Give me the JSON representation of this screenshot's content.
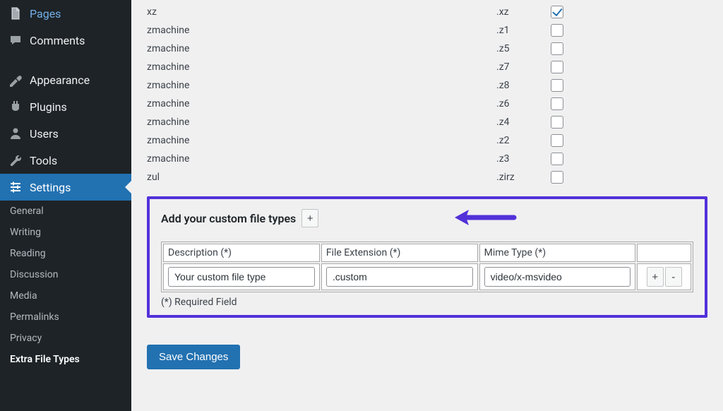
{
  "sidebar": {
    "nav": [
      {
        "label": "Pages",
        "icon": "pages-icon"
      },
      {
        "label": "Comments",
        "icon": "comments-icon"
      },
      {
        "label": "Appearance",
        "icon": "appearance-icon"
      },
      {
        "label": "Plugins",
        "icon": "plugins-icon"
      },
      {
        "label": "Users",
        "icon": "users-icon"
      },
      {
        "label": "Tools",
        "icon": "tools-icon"
      },
      {
        "label": "Settings",
        "icon": "settings-icon",
        "active": true
      }
    ],
    "sub": [
      {
        "label": "General"
      },
      {
        "label": "Writing"
      },
      {
        "label": "Reading"
      },
      {
        "label": "Discussion"
      },
      {
        "label": "Media"
      },
      {
        "label": "Permalinks"
      },
      {
        "label": "Privacy"
      },
      {
        "label": "Extra File Types",
        "current": true
      }
    ]
  },
  "file_types": [
    {
      "desc": "xz",
      "ext": ".xz",
      "checked": true
    },
    {
      "desc": "zmachine",
      "ext": ".z1",
      "checked": false
    },
    {
      "desc": "zmachine",
      "ext": ".z5",
      "checked": false
    },
    {
      "desc": "zmachine",
      "ext": ".z7",
      "checked": false
    },
    {
      "desc": "zmachine",
      "ext": ".z8",
      "checked": false
    },
    {
      "desc": "zmachine",
      "ext": ".z6",
      "checked": false
    },
    {
      "desc": "zmachine",
      "ext": ".z4",
      "checked": false
    },
    {
      "desc": "zmachine",
      "ext": ".z2",
      "checked": false
    },
    {
      "desc": "zmachine",
      "ext": ".z3",
      "checked": false
    },
    {
      "desc": "zul",
      "ext": ".zirz",
      "checked": false
    }
  ],
  "custom_section": {
    "title": "Add your custom file types",
    "add_label": "+",
    "headers": {
      "desc": "Description (*)",
      "ext": "File Extension (*)",
      "mime": "Mime Type (*)"
    },
    "row": {
      "desc": "Your custom file type",
      "ext": ".custom",
      "mime": "video/x-msvideo"
    },
    "plus_label": "+",
    "minus_label": "-",
    "required_note": "(*) Required Field"
  },
  "save_label": "Save Changes"
}
